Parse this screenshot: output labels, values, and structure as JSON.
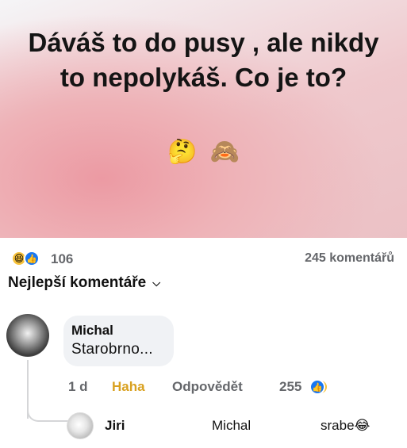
{
  "post": {
    "text": "Dáváš to do pusy , ale nikdy to nepolykáš. Co je to?",
    "emojis": [
      "🤔",
      "🙈"
    ]
  },
  "reactions": {
    "icons": [
      "haha-icon",
      "like-icon"
    ],
    "count": "106",
    "comments_count": "245 komentářů"
  },
  "sort": {
    "label": "Nejlepší komentáře",
    "icon": "chevron-down-icon"
  },
  "comment": {
    "author": "Michal",
    "text": "Starobrno...",
    "actions": {
      "time": "1 d",
      "reaction": "Haha",
      "reply": "Odpovědět",
      "reaction_count": "255"
    },
    "reaction_icons": [
      "haha-icon",
      "like-icon"
    ]
  },
  "reply": {
    "author": "Jiri",
    "mention": "Michal",
    "text": "srabe😂"
  },
  "colors": {
    "haha_label": "#d9a120",
    "like": "#1877f2",
    "meta_text": "#65676b"
  }
}
